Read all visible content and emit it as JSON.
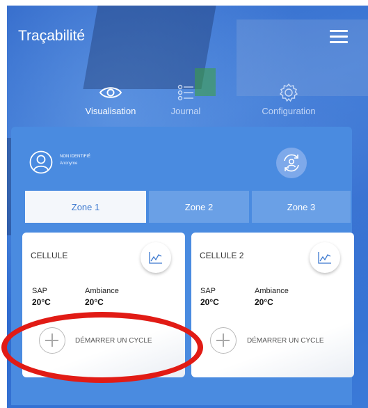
{
  "app": {
    "title": "Traçabilité"
  },
  "nav": {
    "tabs": [
      {
        "label": "Visualisation",
        "icon": "eye-icon"
      },
      {
        "label": "Journal",
        "icon": "list-icon"
      },
      {
        "label": "Configuration",
        "icon": "gear-icon"
      }
    ],
    "active": "Visualisation"
  },
  "user": {
    "status": "NON IDENTIFIÉ",
    "name": "Anonyme"
  },
  "zones": {
    "tabs": [
      "Zone 1",
      "Zone 2",
      "Zone 3"
    ],
    "active": "Zone 1"
  },
  "cells": [
    {
      "title": "CELLULE",
      "sap_label": "SAP",
      "sap_value": "20°C",
      "ambiance_label": "Ambiance",
      "ambiance_value": "20°C",
      "action_label": "DÉMARRER UN CYCLE"
    },
    {
      "title": "CELLULE 2",
      "sap_label": "SAP",
      "sap_value": "20°C",
      "ambiance_label": "Ambiance",
      "ambiance_value": "20°C",
      "action_label": "DÉMARRER UN CYCLE"
    }
  ],
  "colors": {
    "primary": "#3b78cf",
    "panel": "#4a8be0",
    "highlight": "#e11b15"
  }
}
